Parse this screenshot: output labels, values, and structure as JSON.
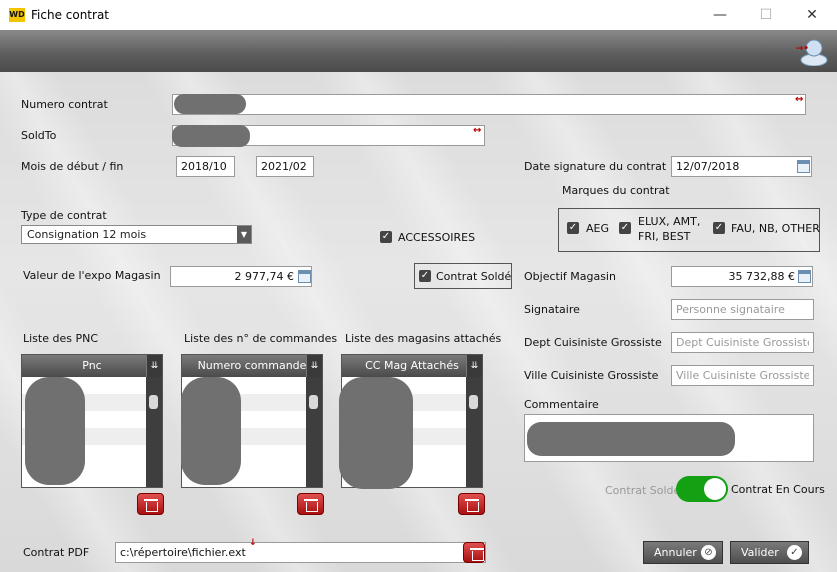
{
  "window": {
    "title": "Fiche contrat",
    "logo_text": "WD",
    "minimize_glyph": "—",
    "maximize_glyph": "☐",
    "close_glyph": "✕"
  },
  "form": {
    "numero_contrat": {
      "label": "Numero contrat"
    },
    "soldto": {
      "label": "SoldTo"
    },
    "mois": {
      "label": "Mois de début / fin",
      "debut": "2018/10",
      "fin": "2021/02"
    },
    "type_contrat": {
      "label": "Type de contrat",
      "value": "Consignation 12 mois"
    },
    "accessoires": {
      "label": "ACCESSOIRES",
      "checked": true
    },
    "valeur_expo": {
      "label": "Valeur de l'expo Magasin",
      "value": "2 977,74 €"
    },
    "contrat_solde_chk": {
      "label": "Contrat Soldé",
      "checked": true
    },
    "date_signature": {
      "label": "Date signature du contrat",
      "value": "12/07/2018"
    },
    "marques": {
      "label": "Marques du contrat",
      "items": [
        {
          "label": "AEG",
          "checked": true
        },
        {
          "label": "ELUX, AMT,\nFRI, BEST",
          "line1": "ELUX, AMT,",
          "line2": "FRI, BEST",
          "checked": true
        },
        {
          "label": "FAU, NB, OTHER",
          "checked": true
        }
      ]
    },
    "objectif": {
      "label": "Objectif Magasin",
      "value": "35 732,88 €"
    },
    "signataire": {
      "label": "Signataire",
      "placeholder": "Personne signataire"
    },
    "dept": {
      "label": "Dept Cuisiniste Grossiste",
      "placeholder": "Dept Cuisiniste Grossiste"
    },
    "ville": {
      "label": "Ville Cuisiniste Grossiste",
      "placeholder": "Ville Cuisiniste Grossiste"
    },
    "commentaire": {
      "label": "Commentaire"
    },
    "contrat_pdf": {
      "label": "Contrat PDF",
      "value": "c:\\répertoire\\fichier.ext"
    }
  },
  "lists": {
    "pnc": {
      "title": "Liste des PNC",
      "column": "Pnc"
    },
    "commandes": {
      "title": "Liste des n° de commandes",
      "column": "Numero commande"
    },
    "magasins": {
      "title": "Liste des magasins attachés",
      "column": "CC Mag Attachés"
    }
  },
  "status_toggle": {
    "off_label": "Contrat Soldé",
    "on_label": "Contrat En Cours",
    "state": "on"
  },
  "buttons": {
    "annuler": "Annuler",
    "valider": "Valider"
  },
  "colors": {
    "toggle_on": "#13a013",
    "delete_red": "#c02020",
    "banner": "#5f5f5f"
  }
}
